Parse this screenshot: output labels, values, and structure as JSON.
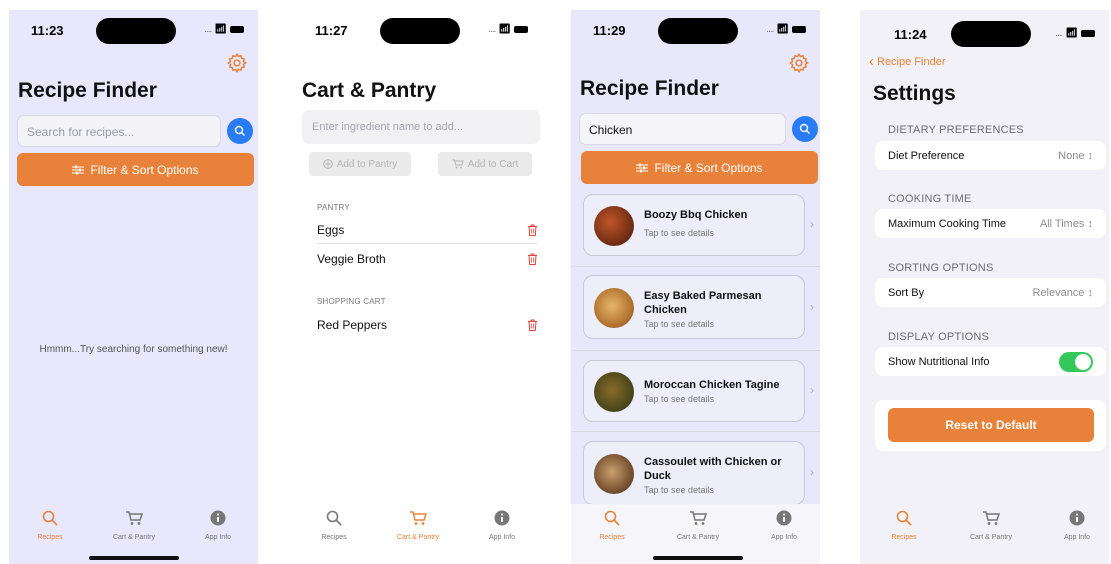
{
  "screen1": {
    "time": "11:23",
    "title": "Recipe Finder",
    "search_placeholder": "Search for recipes...",
    "filter_label": "Filter & Sort Options",
    "empty_message": "Hmmm...Try searching for something new!"
  },
  "screen2": {
    "time": "11:27",
    "title": "Cart & Pantry",
    "ingredient_placeholder": "Enter ingredient name to add...",
    "add_pantry_label": "Add to Pantry",
    "add_cart_label": "Add to Cart",
    "pantry_header": "PANTRY",
    "pantry_items": [
      "Eggs",
      "Veggie Broth"
    ],
    "cart_header": "SHOPPING CART",
    "cart_items": [
      "Red Peppers"
    ]
  },
  "screen3": {
    "time": "11:29",
    "title": "Recipe Finder",
    "search_value": "Chicken",
    "filter_label": "Filter & Sort Options",
    "recipes": [
      {
        "title": "Boozy Bbq Chicken",
        "subtitle": "Tap to see details"
      },
      {
        "title": "Easy Baked Parmesan Chicken",
        "subtitle": "Tap to see details"
      },
      {
        "title": "Moroccan Chicken Tagine",
        "subtitle": "Tap to see details"
      },
      {
        "title": "Cassoulet with Chicken or Duck",
        "subtitle": "Tap to see details"
      }
    ]
  },
  "screen4": {
    "time": "11:24",
    "back_label": "Recipe Finder",
    "title": "Settings",
    "dietary_header": "DIETARY PREFERENCES",
    "diet_label": "Diet Preference",
    "diet_value": "None",
    "cooking_header": "COOKING TIME",
    "cooking_label": "Maximum Cooking Time",
    "cooking_value": "All Times",
    "sorting_header": "SORTING OPTIONS",
    "sort_label": "Sort By",
    "sort_value": "Relevance",
    "display_header": "DISPLAY OPTIONS",
    "nutrition_label": "Show Nutritional Info",
    "nutrition_enabled": true,
    "reset_label": "Reset to Default"
  },
  "tabs": {
    "recipes": "Recipes",
    "cart": "Cart & Pantry",
    "info": "App Info"
  },
  "colors": {
    "accent": "#e8823a",
    "search_button": "#2a7cf6",
    "toggle_on": "#34c759",
    "delete": "#e0423a"
  },
  "icons": {
    "settings": "gear-icon",
    "search": "magnifier-icon",
    "filter": "sliders-icon",
    "delete": "trash-icon",
    "cart": "cart-icon",
    "info": "info-icon"
  }
}
